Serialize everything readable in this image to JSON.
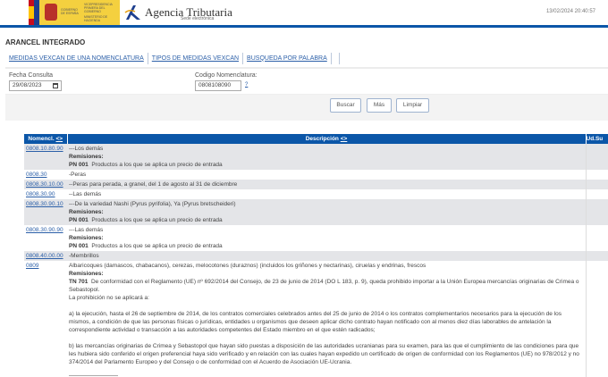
{
  "header": {
    "gov_lines": [
      "GOBIERNO DE ESPAÑA",
      "VICEPRESIDENCIA PRIMERA DEL GOBIERNO",
      "MINISTERIO DE HACIENDA"
    ],
    "agency": "Agencia Tributaria",
    "agency_sub": "Sede electrónica",
    "datetime": "13/02/2024 20:40:57"
  },
  "page_title": "ARANCEL INTEGRADO",
  "tabs": [
    "MEDIDAS VEXCAN DE UNA NOMENCLATURA",
    "TIPOS DE MEDIDAS VEXCAN",
    "BUSQUEDA POR PALABRA"
  ],
  "form": {
    "fecha_label": "Fecha Consulta",
    "fecha_value": "29/08/2023",
    "codigo_label": "Codigo Nomenclatura:",
    "codigo_value": "0808108090",
    "help": "?"
  },
  "buttons": {
    "buscar": "Buscar",
    "mas": "Más",
    "limpiar": "Limpiar"
  },
  "table": {
    "headers": {
      "nomencl": "Nomencl.",
      "descripcion": "Descripción",
      "ud": "Ud.Su",
      "sort": "<>"
    },
    "remisiones_label": "Remisiones:",
    "rows": [
      {
        "code": "0808.10.80.90",
        "desc": "---Los demás",
        "rem_code": "PN 001",
        "rem_text": "Productos a los que se aplica un precio de entrada"
      },
      {
        "code": "0808.30",
        "desc": "-Peras"
      },
      {
        "code": "0808.30.10.00",
        "desc": "--Peras para perada, a granel, del 1 de agosto al 31 de diciembre"
      },
      {
        "code": "0808.30.90",
        "desc": "--Las demás"
      },
      {
        "code": "0808.30.90.10",
        "desc": "---De la variedad Nashi (Pyrus pyrifolia), Ya (Pyrus bretscheideri)",
        "rem_code": "PN 001",
        "rem_text": "Productos a los que se aplica un precio de entrada"
      },
      {
        "code": "0808.30.90.90",
        "desc": "---Las demás",
        "rem_code": "PN 001",
        "rem_text": "Productos a los que se aplica un precio de entrada"
      },
      {
        "code": "0808.40.00.00",
        "desc": "-Membrillos"
      }
    ],
    "last": {
      "code": "0809",
      "desc": "Albaricoques (damascos, chabacanos), cerezas, melocotones (duraznos) (incluidos los griñones y nectarinas), ciruelas y endrinas, frescos",
      "rem_code": "TN 701",
      "rem_text": "De conformidad con el Reglamento (UE) nº 692/2014 del Consejo, de 23 de junio de 2014 (DO L 183, p. 9), queda prohibido importar a la Unión Europea mercancías originarias de Crimea o Sebastopol.",
      "p1": "La prohibición no se aplicará a:",
      "p2": "a) la ejecución, hasta el 26 de septiembre de 2014, de los contratos comerciales celebrados antes del 25 de junio de 2014 o los contratos complementarios necesarios para la ejecución de los mismos, a condición de que las personas físicas o jurídicas, entidades u organismos que deseen aplicar dicho contrato hayan notificado con al menos diez días laborables de antelación la correspondiente actividad o transacción a las autoridades competentes del Estado miembro en el que estén radicados;",
      "p3": "b) las mercancías originarias de Crimea y Sebastopol que hayan sido puestas a disposición de las autoridades ucranianas para su examen, para las que el cumplimiento de las condiciones para que les hubiera sido conferido el origen preferencial haya sido verificado y en relación con las cuales hayan expedido un certificado de origen de conformidad con los Reglamentos (UE) no 978/2012 y no 374/2014 del Parlamento Europeo y del Consejo o de conformidad con el Acuerdo de Asociación UE-Ucrania."
    }
  }
}
